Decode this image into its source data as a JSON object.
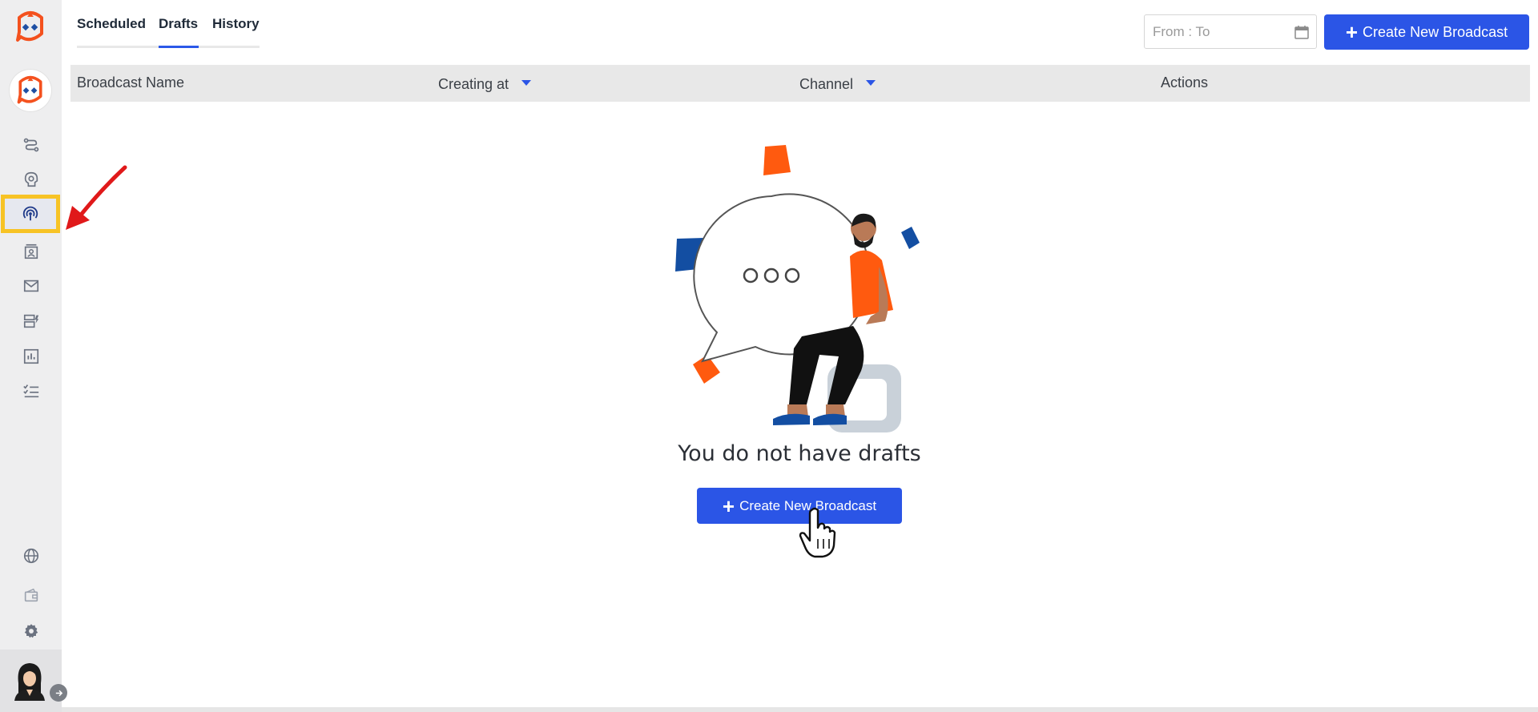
{
  "tabs": [
    {
      "label": "Scheduled",
      "active": false
    },
    {
      "label": "Drafts",
      "active": true
    },
    {
      "label": "History",
      "active": false
    }
  ],
  "date_range": {
    "placeholder": "From : To"
  },
  "create_button": {
    "label": "Create New Broadcast"
  },
  "table": {
    "columns": [
      "Broadcast Name",
      "Creating at",
      "Channel",
      "Actions"
    ]
  },
  "empty_state": {
    "message": "You do not have drafts",
    "button_label": "Create New Broadcast"
  },
  "sidebar": {
    "items": [
      {
        "icon": "flow-icon",
        "active": false
      },
      {
        "icon": "bot-head-icon",
        "active": false
      },
      {
        "icon": "broadcast-icon",
        "active": true
      },
      {
        "icon": "contacts-icon",
        "active": false
      },
      {
        "icon": "mail-icon",
        "active": false
      },
      {
        "icon": "templates-icon",
        "active": false
      },
      {
        "icon": "analytics-icon",
        "active": false
      },
      {
        "icon": "tasks-icon",
        "active": false
      }
    ],
    "bottom_items": [
      {
        "icon": "globe-icon"
      },
      {
        "icon": "wallet-icon"
      },
      {
        "icon": "gear-icon"
      }
    ]
  },
  "colors": {
    "primary": "#2b55e6",
    "brand_orange": "#f4511e",
    "brand_blue": "#1e4fa3",
    "highlight": "#f7c325",
    "annotation": "#e0191a"
  }
}
